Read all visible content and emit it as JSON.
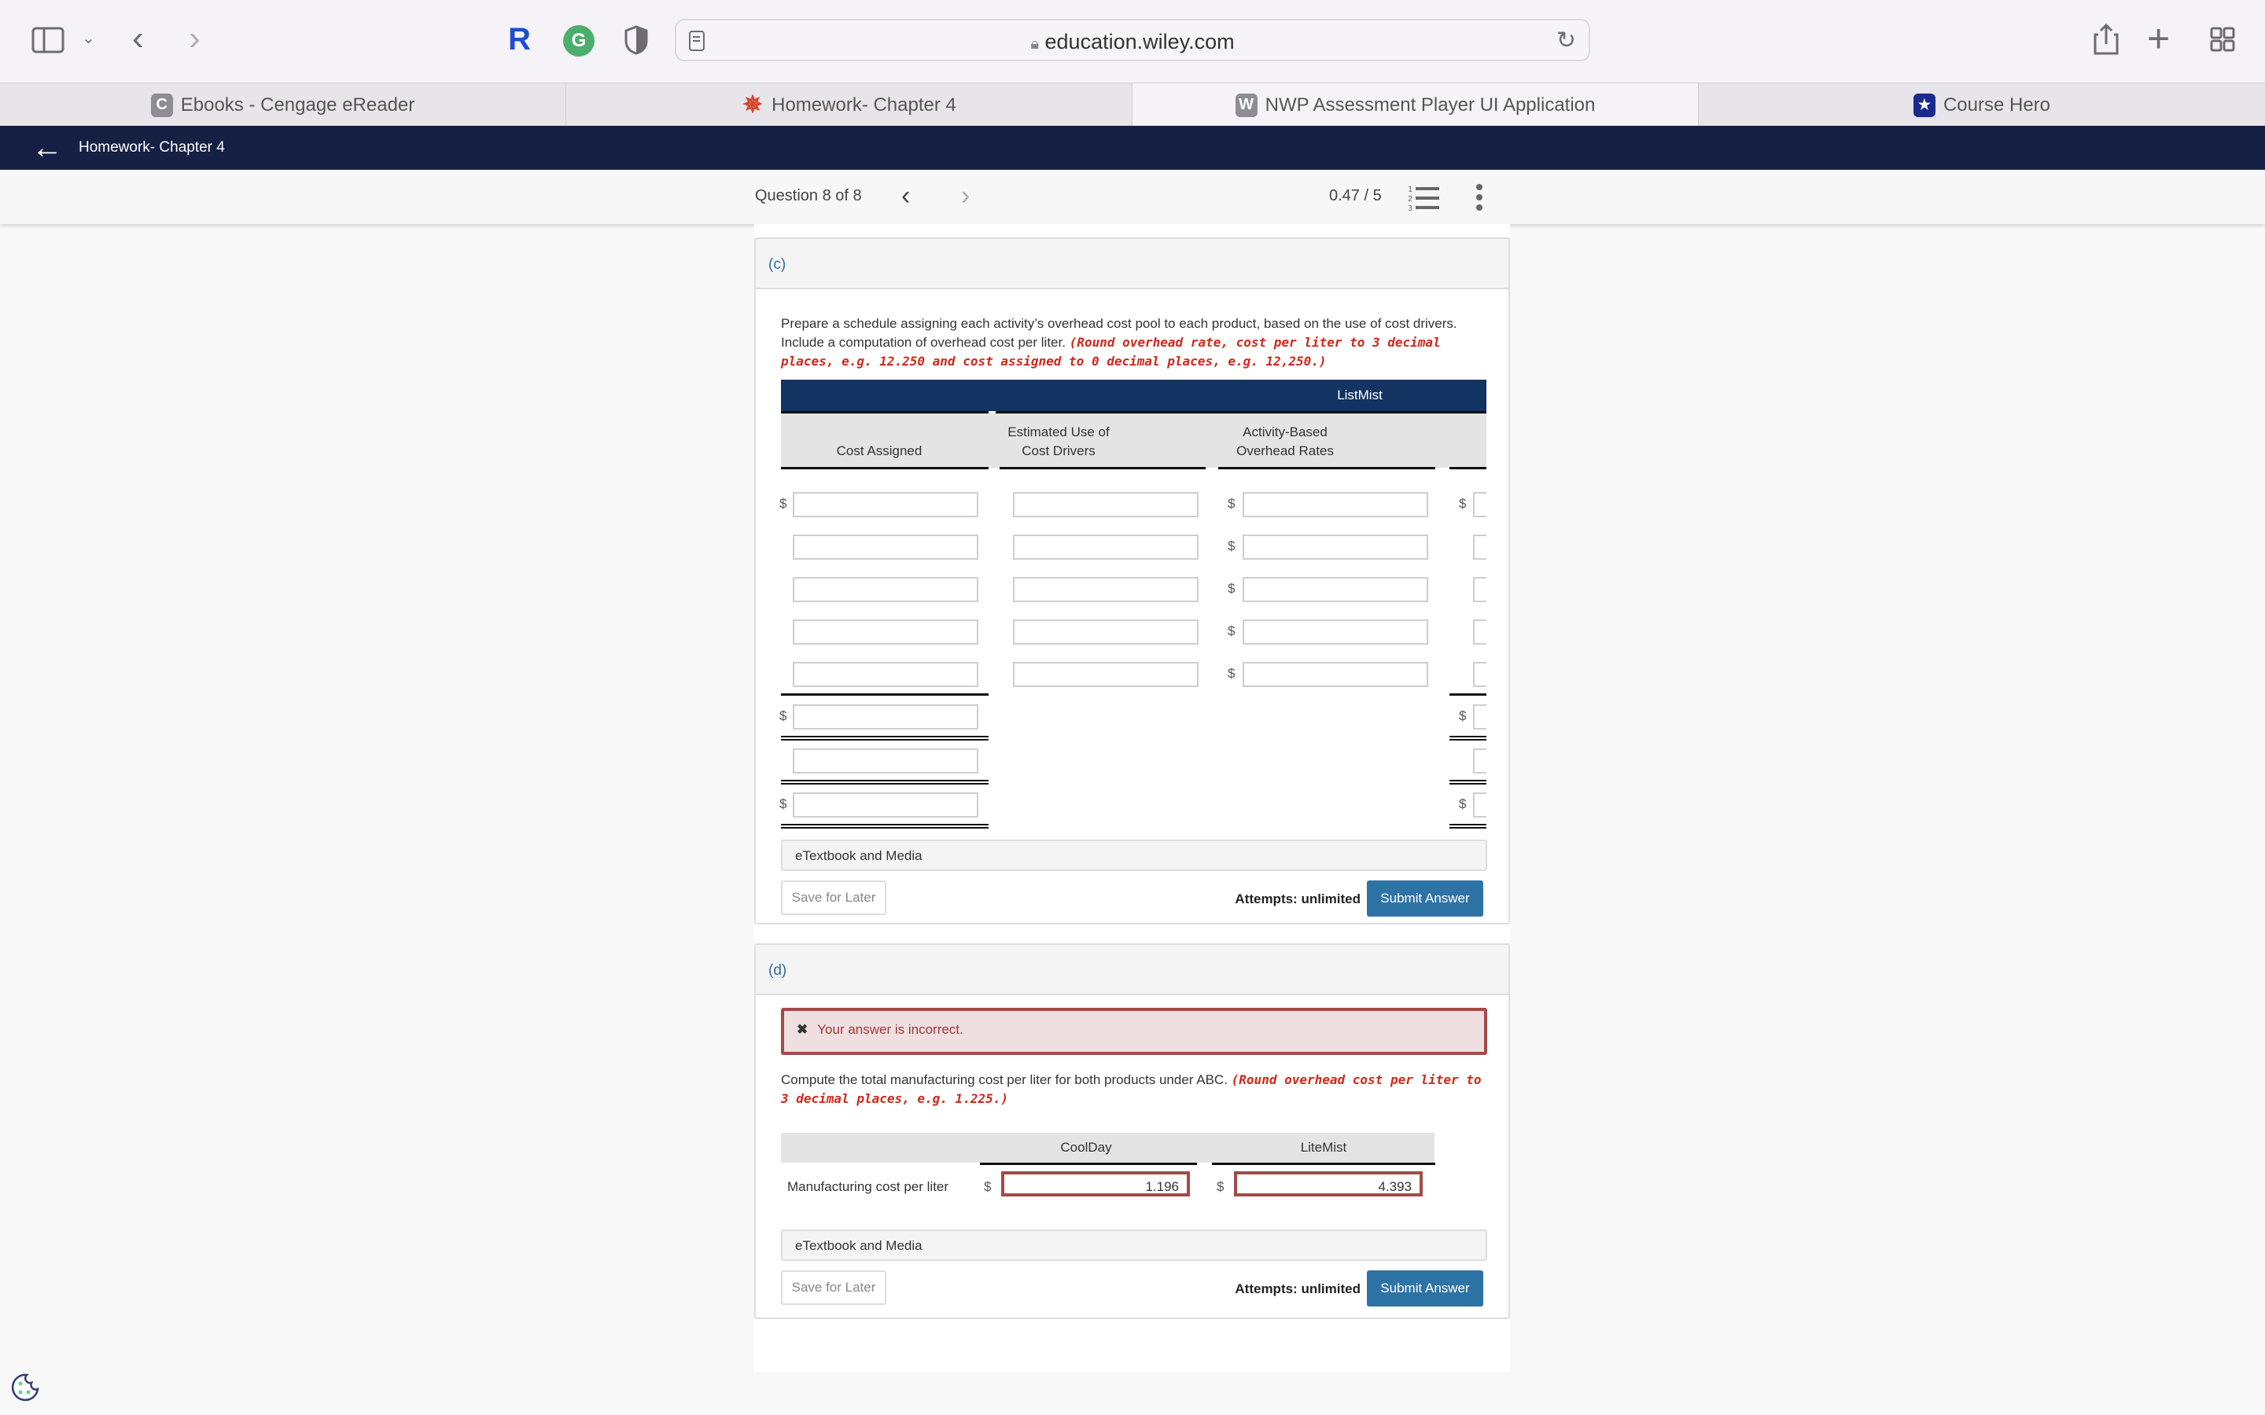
{
  "browser": {
    "url": "education.wiley.com",
    "tabs": [
      {
        "label": "Ebooks - Cengage eReader",
        "icon": "cengage-c-icon",
        "active": false
      },
      {
        "label": "Homework- Chapter 4",
        "icon": "canvas-logo-icon",
        "active": false
      },
      {
        "label": "NWP Assessment Player UI Application",
        "icon": "wiley-w-icon",
        "active": true
      },
      {
        "label": "Course Hero",
        "icon": "course-hero-icon",
        "active": false
      }
    ]
  },
  "app_nav": {
    "back_label": "Homework- Chapter 4"
  },
  "question_bar": {
    "question_label": "Question 8 of 8",
    "score": "0.47 / 5"
  },
  "part_c": {
    "label": "(c)",
    "prompt": "Prepare a schedule assigning each activity’s overhead cost pool to each product, based on the use of cost drivers. Include a computation of overhead cost per liter.",
    "instruction": "(Round overhead rate, cost per liter to 3 decimal places, e.g. 12.250 and cost assigned to 0 decimal places, e.g. 12,250.)",
    "table": {
      "group_header": "ListMist",
      "columns": [
        "Cost Assigned",
        "Estimated Use of Cost Drivers",
        "Activity-Based Overhead Rates",
        ""
      ],
      "currency_symbol": "$",
      "rows": [
        {
          "cost_assigned": "",
          "estimated_use": "",
          "rate": "",
          "right": ""
        },
        {
          "cost_assigned": "",
          "estimated_use": "",
          "rate": "",
          "right": ""
        },
        {
          "cost_assigned": "",
          "estimated_use": "",
          "rate": "",
          "right": ""
        },
        {
          "cost_assigned": "",
          "estimated_use": "",
          "rate": "",
          "right": ""
        },
        {
          "cost_assigned": "",
          "estimated_use": "",
          "rate": "",
          "right": ""
        }
      ],
      "totals": [
        "",
        "",
        ""
      ]
    },
    "etextbook_label": "eTextbook and Media",
    "save_label": "Save for Later",
    "attempts_label": "Attempts: unlimited",
    "submit_label": "Submit Answer"
  },
  "part_d": {
    "label": "(d)",
    "error_message": "Your answer is incorrect.",
    "prompt": "Compute the total manufacturing cost per liter for both products under ABC.",
    "instruction": "(Round overhead cost per liter to 3 decimal places, e.g. 1.225.)",
    "table": {
      "columns": [
        "CoolDay",
        "LiteMist"
      ],
      "row_label": "Manufacturing cost per liter",
      "currency_symbol": "$",
      "values": [
        "1.196",
        "4.393"
      ]
    },
    "etextbook_label": "eTextbook and Media",
    "save_label": "Save for Later",
    "attempts_label": "Attempts: unlimited",
    "submit_label": "Submit Answer"
  }
}
